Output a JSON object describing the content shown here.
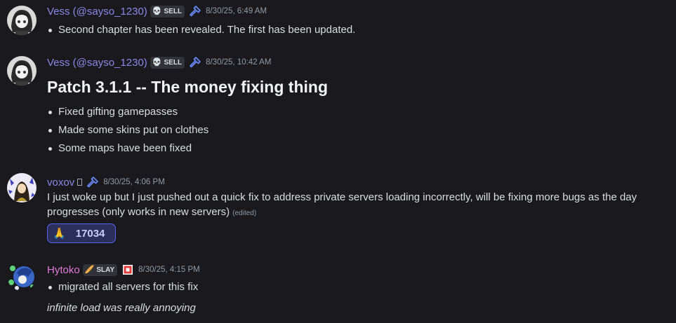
{
  "messages": [
    {
      "username": "Vess (@sayso_1230)",
      "username_color": "#8f86e8",
      "tag_emoji": "💀",
      "tag_label": "SELL",
      "role_icon": "hammer-icon",
      "timestamp": "8/30/25, 6:49 AM",
      "bullets": [
        "Second chapter has been revealed. The first has been updated."
      ]
    },
    {
      "username": "Vess (@sayso_1230)",
      "username_color": "#8f86e8",
      "tag_emoji": "💀",
      "tag_label": "SELL",
      "role_icon": "hammer-icon",
      "timestamp": "8/30/25, 10:42 AM",
      "heading": "Patch 3.1.1 -- The money fixing thing",
      "bullets": [
        "Fixed gifting gamepasses",
        "Made some skins put on clothes",
        "Some maps have been fixed"
      ]
    },
    {
      "username": "voxov",
      "username_color": "#8f86e8",
      "role_icon": "hammer-icon",
      "timestamp": "8/30/25, 4:06 PM",
      "text": "I just woke up but I just pushed out a quick fix to address private servers loading incorrectly, will be fixing more bugs as the day progresses (only works in new servers)",
      "edited_label": "(edited)",
      "reaction": {
        "emoji": "🙏",
        "count": "17034"
      }
    },
    {
      "username": "Hytoko",
      "username_color": "#e27bd8",
      "tag_emoji": "🥖",
      "tag_label": "SLAY",
      "role_icon": "roblox-icon",
      "timestamp": "8/30/25, 4:15 PM",
      "bullets": [
        "migrated all servers for this fix"
      ],
      "italic": "infinite load was really annoying"
    }
  ],
  "colors": {
    "background": "#1a1a1e",
    "text": "#dbdee1",
    "muted": "#949ba4",
    "accent": "#5865f2"
  }
}
